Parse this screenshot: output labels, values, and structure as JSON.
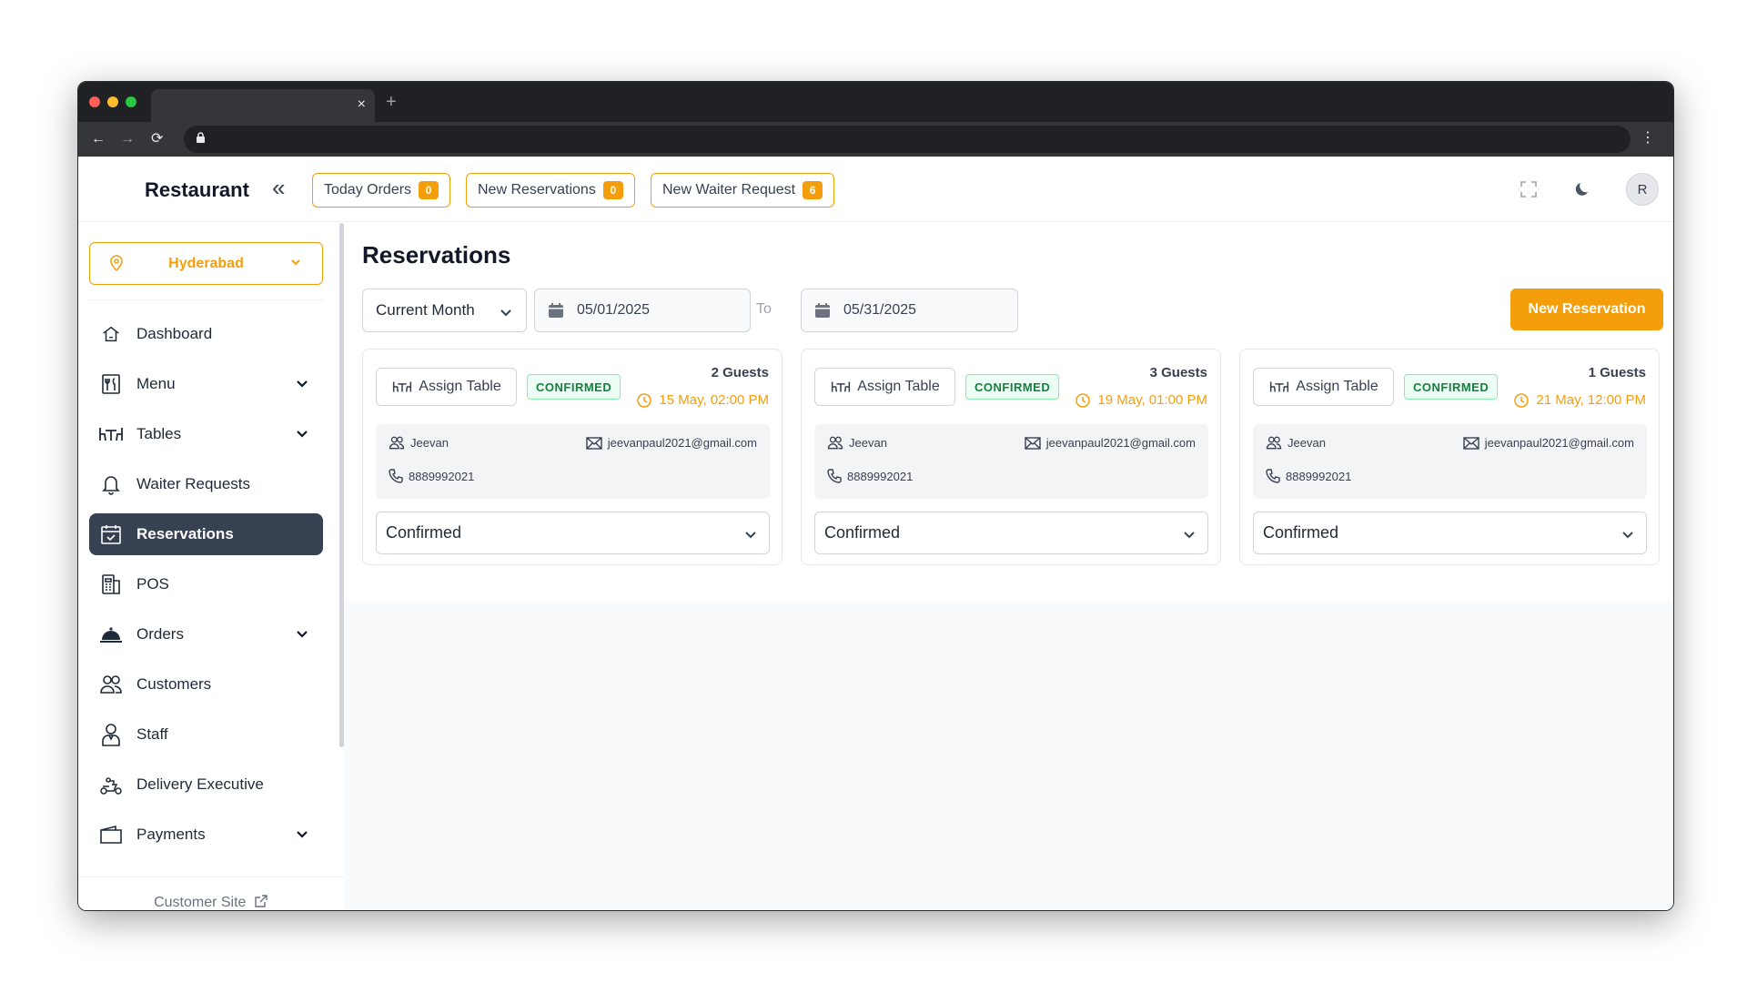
{
  "browser": {
    "tab_close": "×",
    "new_tab": "+",
    "back": "←",
    "forward": "→",
    "reload": "⟳",
    "menu": "⋮"
  },
  "header": {
    "brand": "Restaurant",
    "collapse_icon": "«",
    "today_orders": {
      "label": "Today Orders",
      "count": "0"
    },
    "new_reservations": {
      "label": "New Reservations",
      "count": "0"
    },
    "new_waiter_request": {
      "label": "New Waiter Request",
      "count": "6"
    },
    "avatar_initial": "R"
  },
  "sidebar": {
    "location": "Hyderabad",
    "items": [
      {
        "label": "Dashboard",
        "icon": "home-icon"
      },
      {
        "label": "Menu",
        "icon": "menu-book-icon",
        "expandable": true
      },
      {
        "label": "Tables",
        "icon": "table-icon",
        "expandable": true
      },
      {
        "label": "Waiter Requests",
        "icon": "bell-icon"
      },
      {
        "label": "Reservations",
        "icon": "calendar-check-icon",
        "active": true
      },
      {
        "label": "POS",
        "icon": "pos-icon"
      },
      {
        "label": "Orders",
        "icon": "cloche-icon",
        "expandable": true
      },
      {
        "label": "Customers",
        "icon": "users-icon"
      },
      {
        "label": "Staff",
        "icon": "staff-icon"
      },
      {
        "label": "Delivery Executive",
        "icon": "scooter-icon"
      },
      {
        "label": "Payments",
        "icon": "wallet-icon",
        "expandable": true
      }
    ],
    "customer_site": "Customer Site"
  },
  "main": {
    "title": "Reservations",
    "filter": {
      "range": "Current Month",
      "from": "05/01/2025",
      "to_label": "To",
      "to": "05/31/2025"
    },
    "new_reservation": "New Reservation",
    "cards": [
      {
        "assign_label": "Assign Table",
        "status_badge": "CONFIRMED",
        "guests": "2 Guests",
        "datetime": "15 May, 02:00 PM",
        "name": "Jeevan",
        "email": "jeevanpaul2021@gmail.com",
        "phone": "8889992021",
        "status": "Confirmed"
      },
      {
        "assign_label": "Assign Table",
        "status_badge": "CONFIRMED",
        "guests": "3 Guests",
        "datetime": "19 May, 01:00 PM",
        "name": "Jeevan",
        "email": "jeevanpaul2021@gmail.com",
        "phone": "8889992021",
        "status": "Confirmed"
      },
      {
        "assign_label": "Assign Table",
        "status_badge": "CONFIRMED",
        "guests": "1 Guests",
        "datetime": "21 May, 12:00 PM",
        "name": "Jeevan",
        "email": "jeevanpaul2021@gmail.com",
        "phone": "8889992021",
        "status": "Confirmed"
      }
    ]
  },
  "colors": {
    "accent": "#f59e0b",
    "active_nav": "#374151",
    "confirmed_text": "#15803d",
    "confirmed_bg": "#ecfdf5"
  }
}
